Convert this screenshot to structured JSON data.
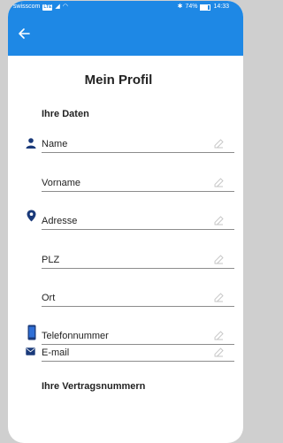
{
  "status": {
    "carrier": "swisscom",
    "network_badge": "LTE",
    "battery": "74%",
    "battery_level": 0.74,
    "time": "14:33"
  },
  "appbar": {
    "back_icon": "arrow-left-icon",
    "color": "#1e88e5"
  },
  "page": {
    "title": "Mein Profil"
  },
  "sections": {
    "personal": "Ihre Daten",
    "contracts": "Ihre Vertragsnummern"
  },
  "fields": [
    {
      "label": "Name",
      "icon": "person-icon"
    },
    {
      "label": "Vorname",
      "icon": ""
    },
    {
      "label": "Adresse",
      "icon": "location-pin-icon"
    },
    {
      "label": "PLZ",
      "icon": ""
    },
    {
      "label": "Ort",
      "icon": ""
    },
    {
      "label": "Telefonnummer",
      "icon": "phone-icon"
    },
    {
      "label": "E-mail",
      "icon": "mail-icon"
    }
  ],
  "colors": {
    "accent": "#1e88e5",
    "icon": "#1a3a7a",
    "edit_icon": "#c4c4c4"
  }
}
